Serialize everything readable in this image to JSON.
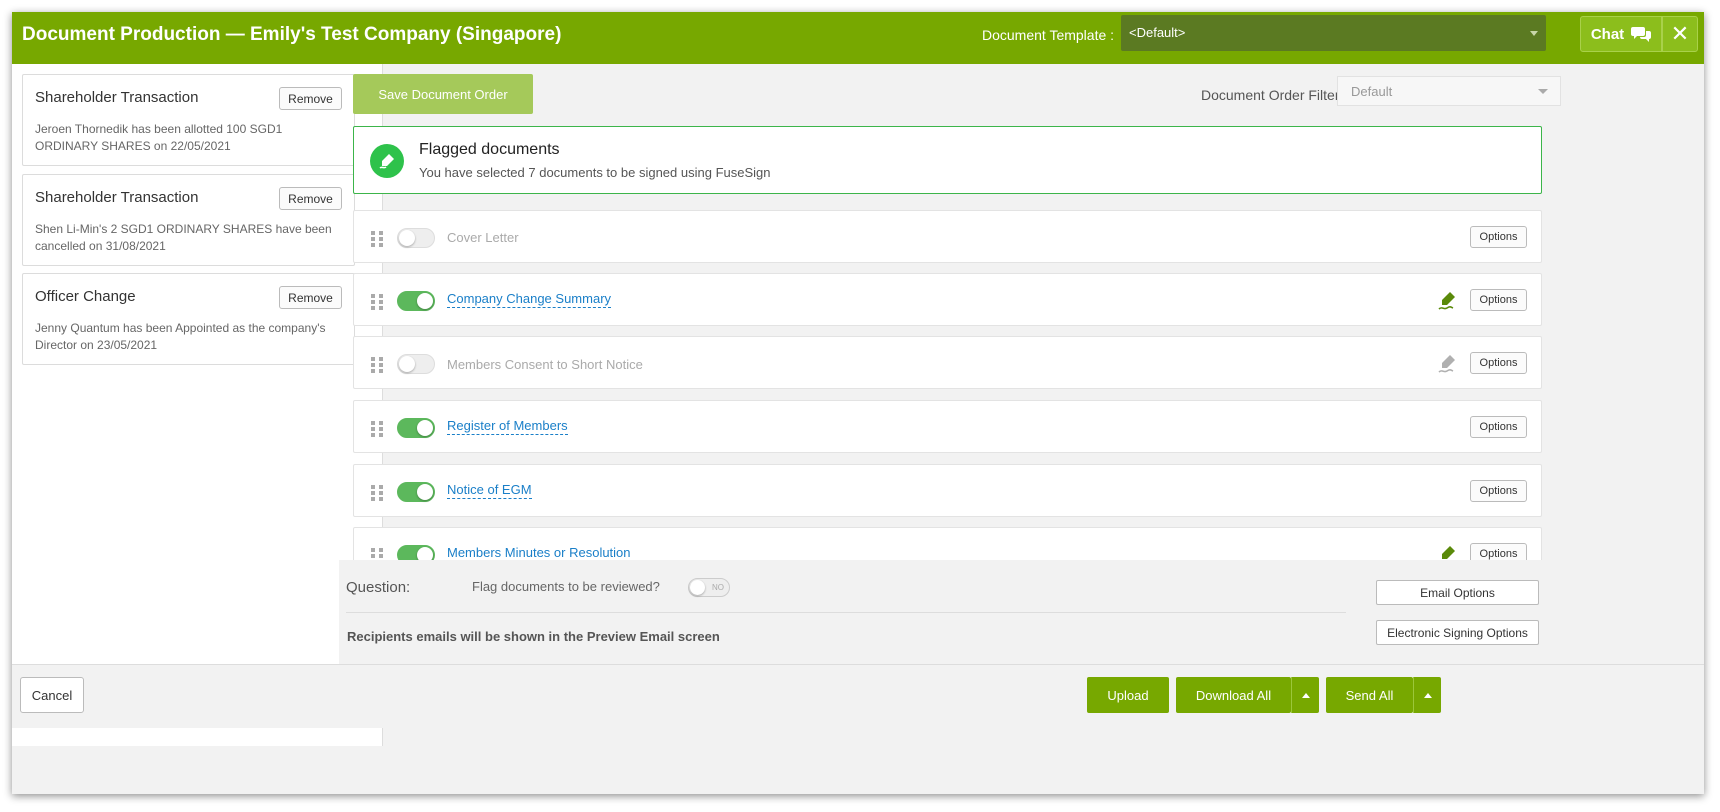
{
  "header": {
    "title": "Document Production — Emily's Test Company (Singapore)",
    "template_label": "Document Template :",
    "template_value": "<Default>",
    "chat_label": "Chat"
  },
  "transactions": [
    {
      "title": "Shareholder Transaction",
      "remove_label": "Remove",
      "description": "Jeroen Thornedik has been allotted 100 SGD1 ORDINARY SHARES on 22/05/2021"
    },
    {
      "title": "Shareholder Transaction",
      "remove_label": "Remove",
      "description": "Shen Li-Min's 2 SGD1 ORDINARY SHARES have been cancelled on 31/08/2021"
    },
    {
      "title": "Officer Change",
      "remove_label": "Remove",
      "description": "Jenny Quantum has been Appointed as the company's Director on 23/05/2021"
    }
  ],
  "toolbar": {
    "save_order_label": "Save Document Order",
    "filter_label": "Document Order Filter",
    "filter_value": "Default"
  },
  "flagged": {
    "title": "Flagged documents",
    "subtitle": "You have selected 7 documents to be signed using FuseSign"
  },
  "documents": [
    {
      "name": "Cover Letter",
      "enabled": false,
      "sign": "none",
      "options_label": "Options"
    },
    {
      "name": "Company Change Summary",
      "enabled": true,
      "sign": "active",
      "options_label": "Options"
    },
    {
      "name": "Members Consent to Short Notice",
      "enabled": false,
      "sign": "inactive",
      "options_label": "Options"
    },
    {
      "name": "Register of Members",
      "enabled": true,
      "sign": "none",
      "options_label": "Options"
    },
    {
      "name": "Notice of EGM",
      "enabled": true,
      "sign": "none",
      "options_label": "Options"
    },
    {
      "name": "Members Minutes or Resolution",
      "enabled": true,
      "sign": "active",
      "options_label": "Options"
    }
  ],
  "question": {
    "label": "Question:",
    "text": "Flag documents to be reviewed?",
    "toggle_text": "NO",
    "recipients_note": "Recipients emails will be shown in the Preview Email screen",
    "email_options_label": "Email Options",
    "signing_options_label": "Electronic Signing Options"
  },
  "footer": {
    "cancel_label": "Cancel",
    "upload_label": "Upload",
    "download_all_label": "Download All",
    "send_all_label": "Send All"
  },
  "colors": {
    "brand_green": "#77a800",
    "link_blue": "#1a7fc8",
    "flag_green": "#2ec24b",
    "sign_active": "#5a8a0a",
    "sign_inactive": "#b0b0b0"
  }
}
